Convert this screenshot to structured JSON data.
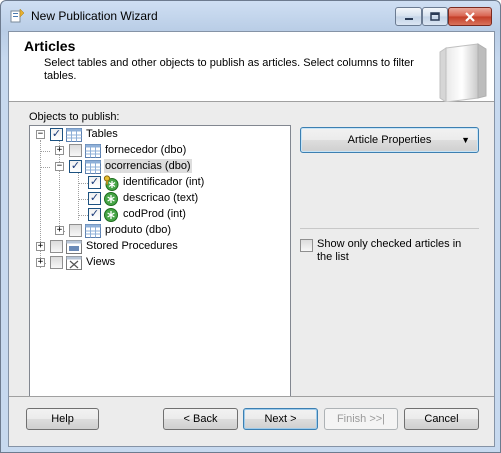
{
  "window": {
    "title": "New Publication Wizard"
  },
  "header": {
    "title": "Articles",
    "description": "Select tables and other objects to publish as articles. Select columns to filter tables."
  },
  "objects_label": "Objects to publish:",
  "tree": {
    "tables_label": "Tables",
    "fornecedor": "fornecedor (dbo)",
    "ocorrencias": "ocorrencias (dbo)",
    "identificador": "identificador (int)",
    "descricao": "descricao (text)",
    "codProd": "codProd (int)",
    "produto": "produto (dbo)",
    "stored_procedures": "Stored Procedures",
    "views": "Views"
  },
  "article_properties_label": "Article Properties",
  "show_only_checked_label": "Show only checked articles in the list",
  "buttons": {
    "help": "Help",
    "back": "< Back",
    "next": "Next >",
    "finish": "Finish >>|",
    "cancel": "Cancel"
  },
  "colors": {
    "accent_border": "#3c7fb1",
    "close_button": "#c33d27",
    "selected_row": "#dddddd"
  }
}
